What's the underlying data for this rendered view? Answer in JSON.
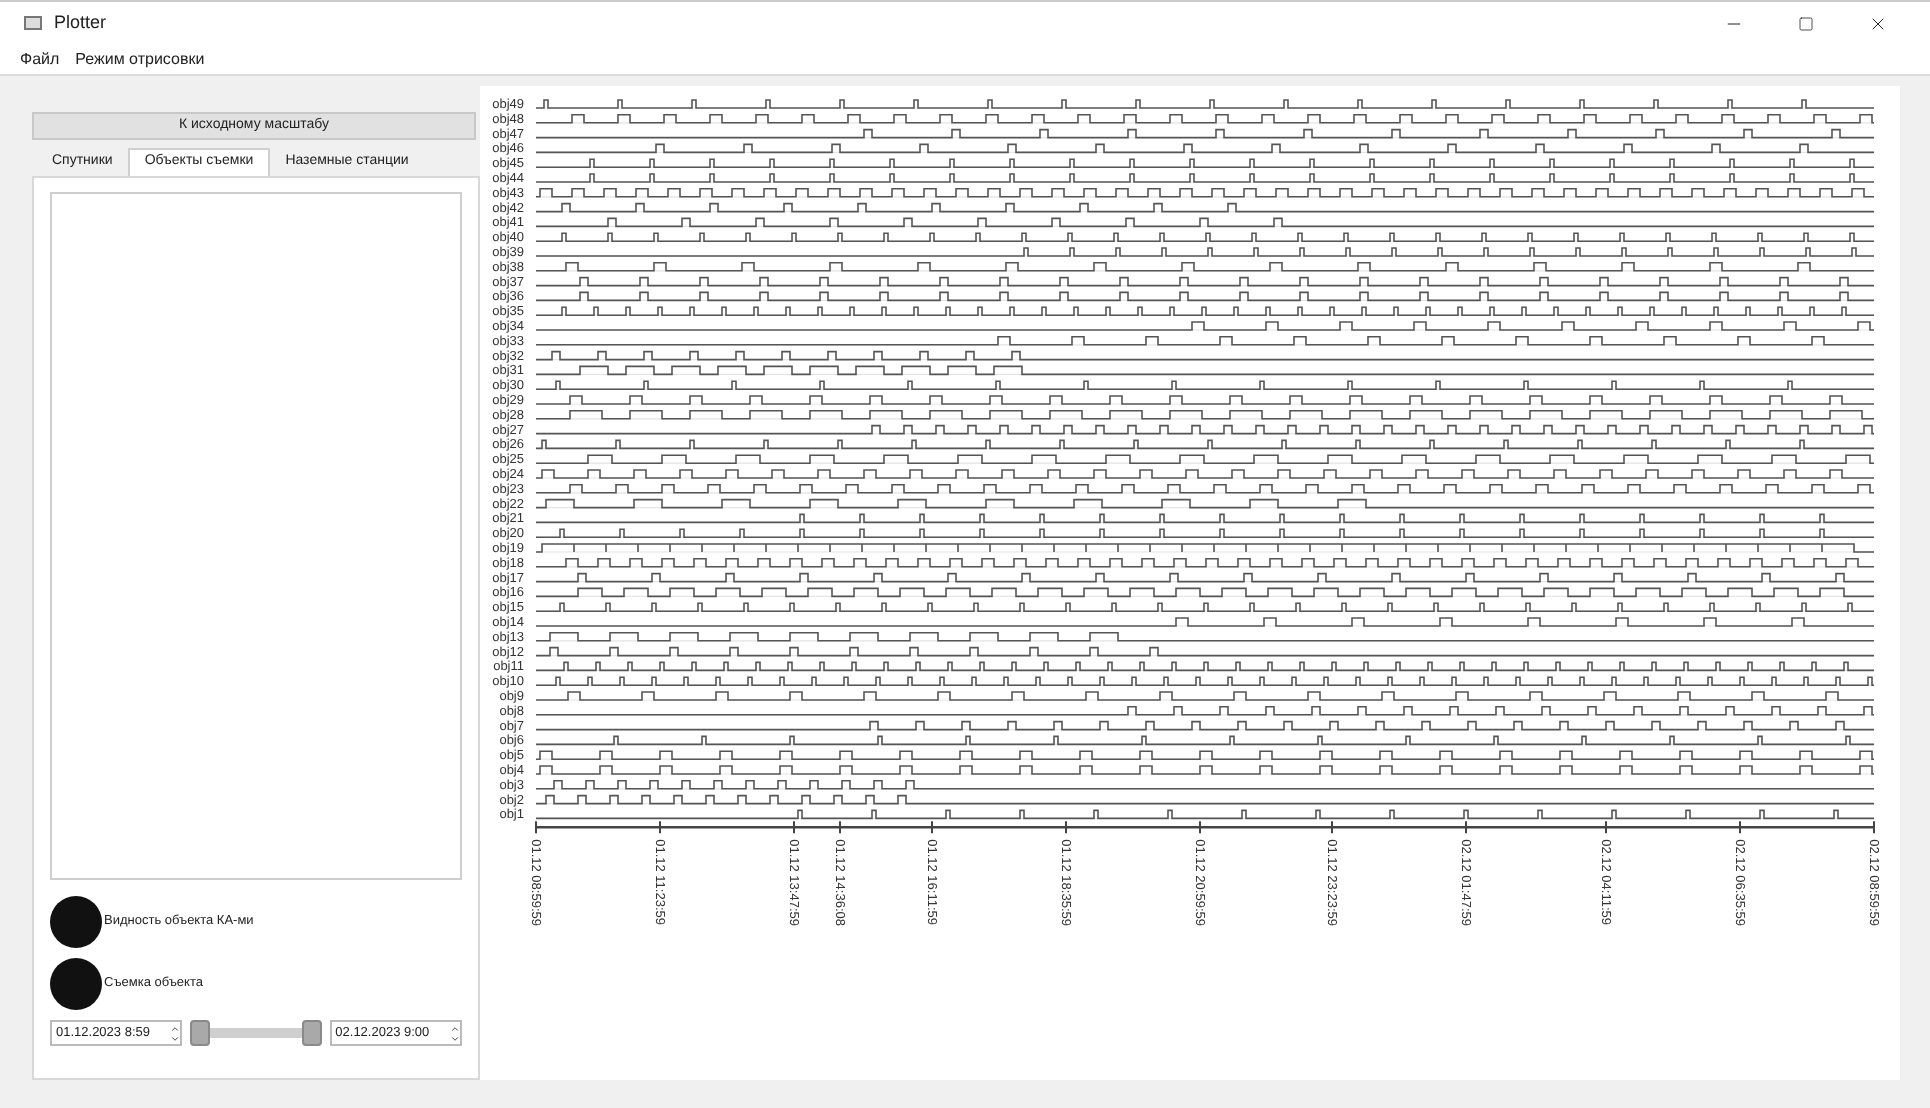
{
  "window": {
    "title": "Plotter"
  },
  "menu": [
    "Файл",
    "Режим отрисовки"
  ],
  "reset_button": "К исходному масштабу",
  "tabs": [
    {
      "label": "Спутники",
      "selected": false
    },
    {
      "label": "Объекты съемки",
      "selected": true
    },
    {
      "label": "Наземные станции",
      "selected": false
    }
  ],
  "legend": [
    {
      "label": "Видность объекта КА-ми",
      "color": "#111111"
    },
    {
      "label": "Съемка объекта",
      "color": "#111111"
    }
  ],
  "range": {
    "start": "01.12.2023 8:59",
    "end": "02.12.2023 9:00",
    "handles": [
      {
        "level": 0
      },
      {
        "level": 1
      }
    ]
  },
  "timeline": {
    "rows": [
      "obj49",
      "obj48",
      "obj47",
      "obj46",
      "obj45",
      "obj44",
      "obj43",
      "obj42",
      "obj41",
      "obj40",
      "obj39",
      "obj38",
      "obj37",
      "obj36",
      "obj35",
      "obj34",
      "obj33",
      "obj32",
      "obj31",
      "obj30",
      "obj29",
      "obj28",
      "obj27",
      "obj26",
      "obj25",
      "obj24",
      "obj23",
      "obj22",
      "obj21",
      "obj20",
      "obj19",
      "obj18",
      "obj17",
      "obj16",
      "obj15",
      "obj14",
      "obj13",
      "obj12",
      "obj11",
      "obj10",
      "obj9",
      "obj8",
      "obj7",
      "obj6",
      "obj5",
      "obj4",
      "obj3",
      "obj2",
      "obj1"
    ],
    "time_labels": [
      "01.12 08:59:59",
      "01.12 11:23:59",
      "01.12 13:47:59",
      "01.12 14:36:08",
      "01.12 16:11:59",
      "01.12 18:35:59",
      "01.12 20:59:59",
      "01.12 23:23:59",
      "02.12 01:47:59",
      "02.12 04:11:59",
      "02.12 06:35:59",
      "02.12 08:59:59"
    ]
  }
}
